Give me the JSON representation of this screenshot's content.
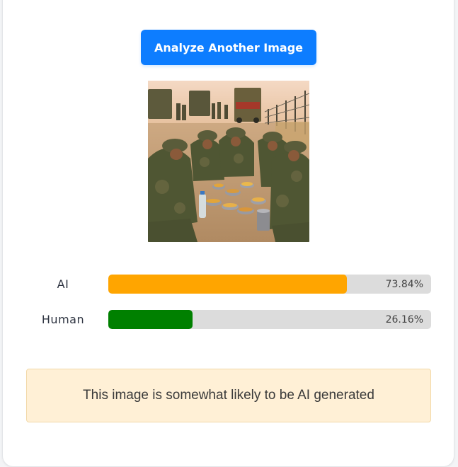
{
  "actions": {
    "analyze_label": "Analyze Another Image"
  },
  "uploaded_image": {
    "description_icon": "photo-thumbnail"
  },
  "results": [
    {
      "label": "AI",
      "percent_text": "73.84%",
      "fraction": 0.7384,
      "color": "#ffa500"
    },
    {
      "label": "Human",
      "percent_text": "26.16%",
      "fraction": 0.2616,
      "color": "#008000"
    }
  ],
  "verdict": {
    "text": "This image is somewhat likely to be AI generated"
  },
  "colors": {
    "primary": "#0d7dff",
    "track": "#dcdcdc",
    "verdict_bg": "#fff0d6"
  }
}
